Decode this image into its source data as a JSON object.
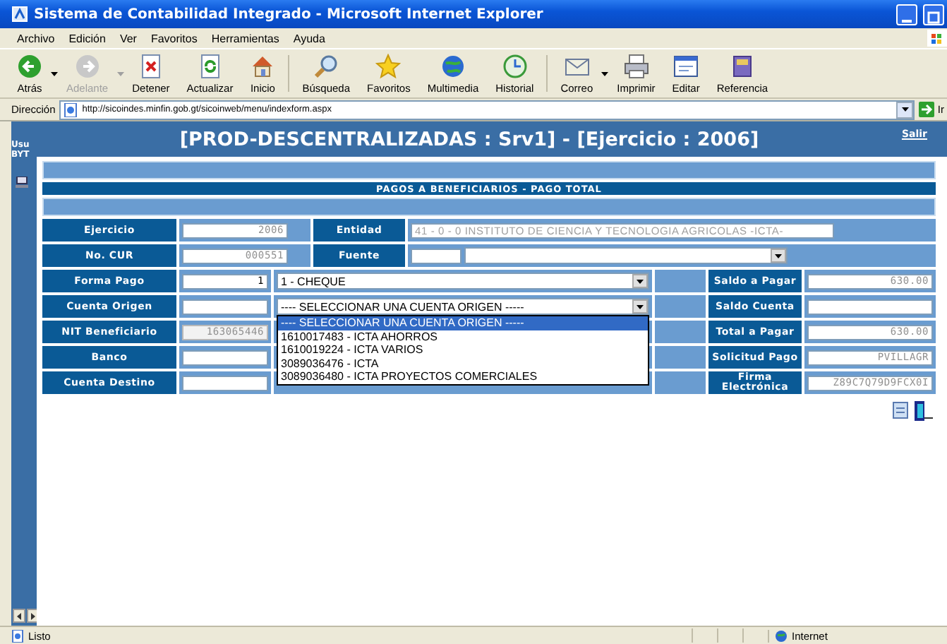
{
  "window": {
    "title": "Sistema de Contabilidad Integrado - Microsoft Internet Explorer"
  },
  "menu": [
    "Archivo",
    "Edición",
    "Ver",
    "Favoritos",
    "Herramientas",
    "Ayuda"
  ],
  "toolbar": [
    {
      "kind": "back",
      "label": "Atrás",
      "disabled": false,
      "caret": true
    },
    {
      "kind": "forward",
      "label": "Adelante",
      "disabled": true,
      "caret": true
    },
    {
      "kind": "stop",
      "label": "Detener",
      "disabled": false,
      "caret": false
    },
    {
      "kind": "refresh",
      "label": "Actualizar",
      "disabled": false,
      "caret": false
    },
    {
      "kind": "home",
      "label": "Inicio",
      "disabled": false,
      "caret": false
    },
    {
      "kind": "search",
      "label": "Búsqueda",
      "disabled": false,
      "caret": false,
      "sep_before": true
    },
    {
      "kind": "favorites",
      "label": "Favoritos",
      "disabled": false,
      "caret": false
    },
    {
      "kind": "media",
      "label": "Multimedia",
      "disabled": false,
      "caret": false
    },
    {
      "kind": "history",
      "label": "Historial",
      "disabled": false,
      "caret": false
    },
    {
      "kind": "mail",
      "label": "Correo",
      "disabled": false,
      "caret": true,
      "sep_before": true
    },
    {
      "kind": "print",
      "label": "Imprimir",
      "disabled": false,
      "caret": false
    },
    {
      "kind": "edit",
      "label": "Editar",
      "disabled": false,
      "caret": false
    },
    {
      "kind": "research",
      "label": "Referencia",
      "disabled": false,
      "caret": false
    }
  ],
  "address": {
    "label": "Dirección",
    "url": "http://sicoindes.minfin.gob.gt/sicoinweb/menu/indexform.aspx",
    "go": "Ir"
  },
  "sidebar": {
    "texts": [
      "Usu",
      "BYT"
    ]
  },
  "header": {
    "title": "[PROD-DESCENTRALIZADAS : Srv1] - [Ejercicio : 2006]",
    "logout": "Salir"
  },
  "section_title": "PAGOS A BENEFICIARIOS - PAGO TOTAL",
  "top_rows": [
    {
      "label": "Ejercicio",
      "value": "2006",
      "label2": "Entidad",
      "value2": "41 - 0 - 0 INSTITUTO DE CIENCIA Y TECNOLOGIA AGRICOLAS -ICTA-",
      "kind": "text"
    },
    {
      "label": "No. CUR",
      "value": "000551",
      "label2": "Fuente",
      "kind": "select"
    }
  ],
  "rows": [
    {
      "label": "Forma Pago",
      "value": "1",
      "disabled": false,
      "select": "1 - CHEQUE",
      "expanded": false,
      "right_label": "Saldo a Pagar",
      "right_value": "630.00"
    },
    {
      "label": "Cuenta Origen",
      "disabled": false,
      "select": "---- SELECCIONAR UNA CUENTA ORIGEN -----",
      "expanded": true,
      "right_label": "Saldo Cuenta"
    },
    {
      "label": "NIT Beneficiario",
      "value": "163065446",
      "disabled": true,
      "right_label": "Total a Pagar",
      "right_value": "630.00"
    },
    {
      "label": "Banco",
      "disabled": false,
      "right_label": "Solicitud Pago",
      "right_value": "PVILLAGR"
    },
    {
      "label": "Cuenta Destino",
      "disabled": false,
      "right_label": "Firma Electrónica",
      "right_value": "Z89C7Q79D9FCX0I"
    }
  ],
  "dropdown_options": [
    {
      "label": "---- SELECCIONAR UNA CUENTA ORIGEN -----",
      "selected": true
    },
    {
      "label": "1610017483 - ICTA AHORROS",
      "selected": false
    },
    {
      "label": "1610019224 - ICTA VARIOS",
      "selected": false
    },
    {
      "label": "3089036476 - ICTA",
      "selected": false
    },
    {
      "label": "3089036480 - ICTA PROYECTOS COMERCIALES",
      "selected": false
    }
  ],
  "status_bar": {
    "text": "Listo",
    "zone": "Internet"
  }
}
